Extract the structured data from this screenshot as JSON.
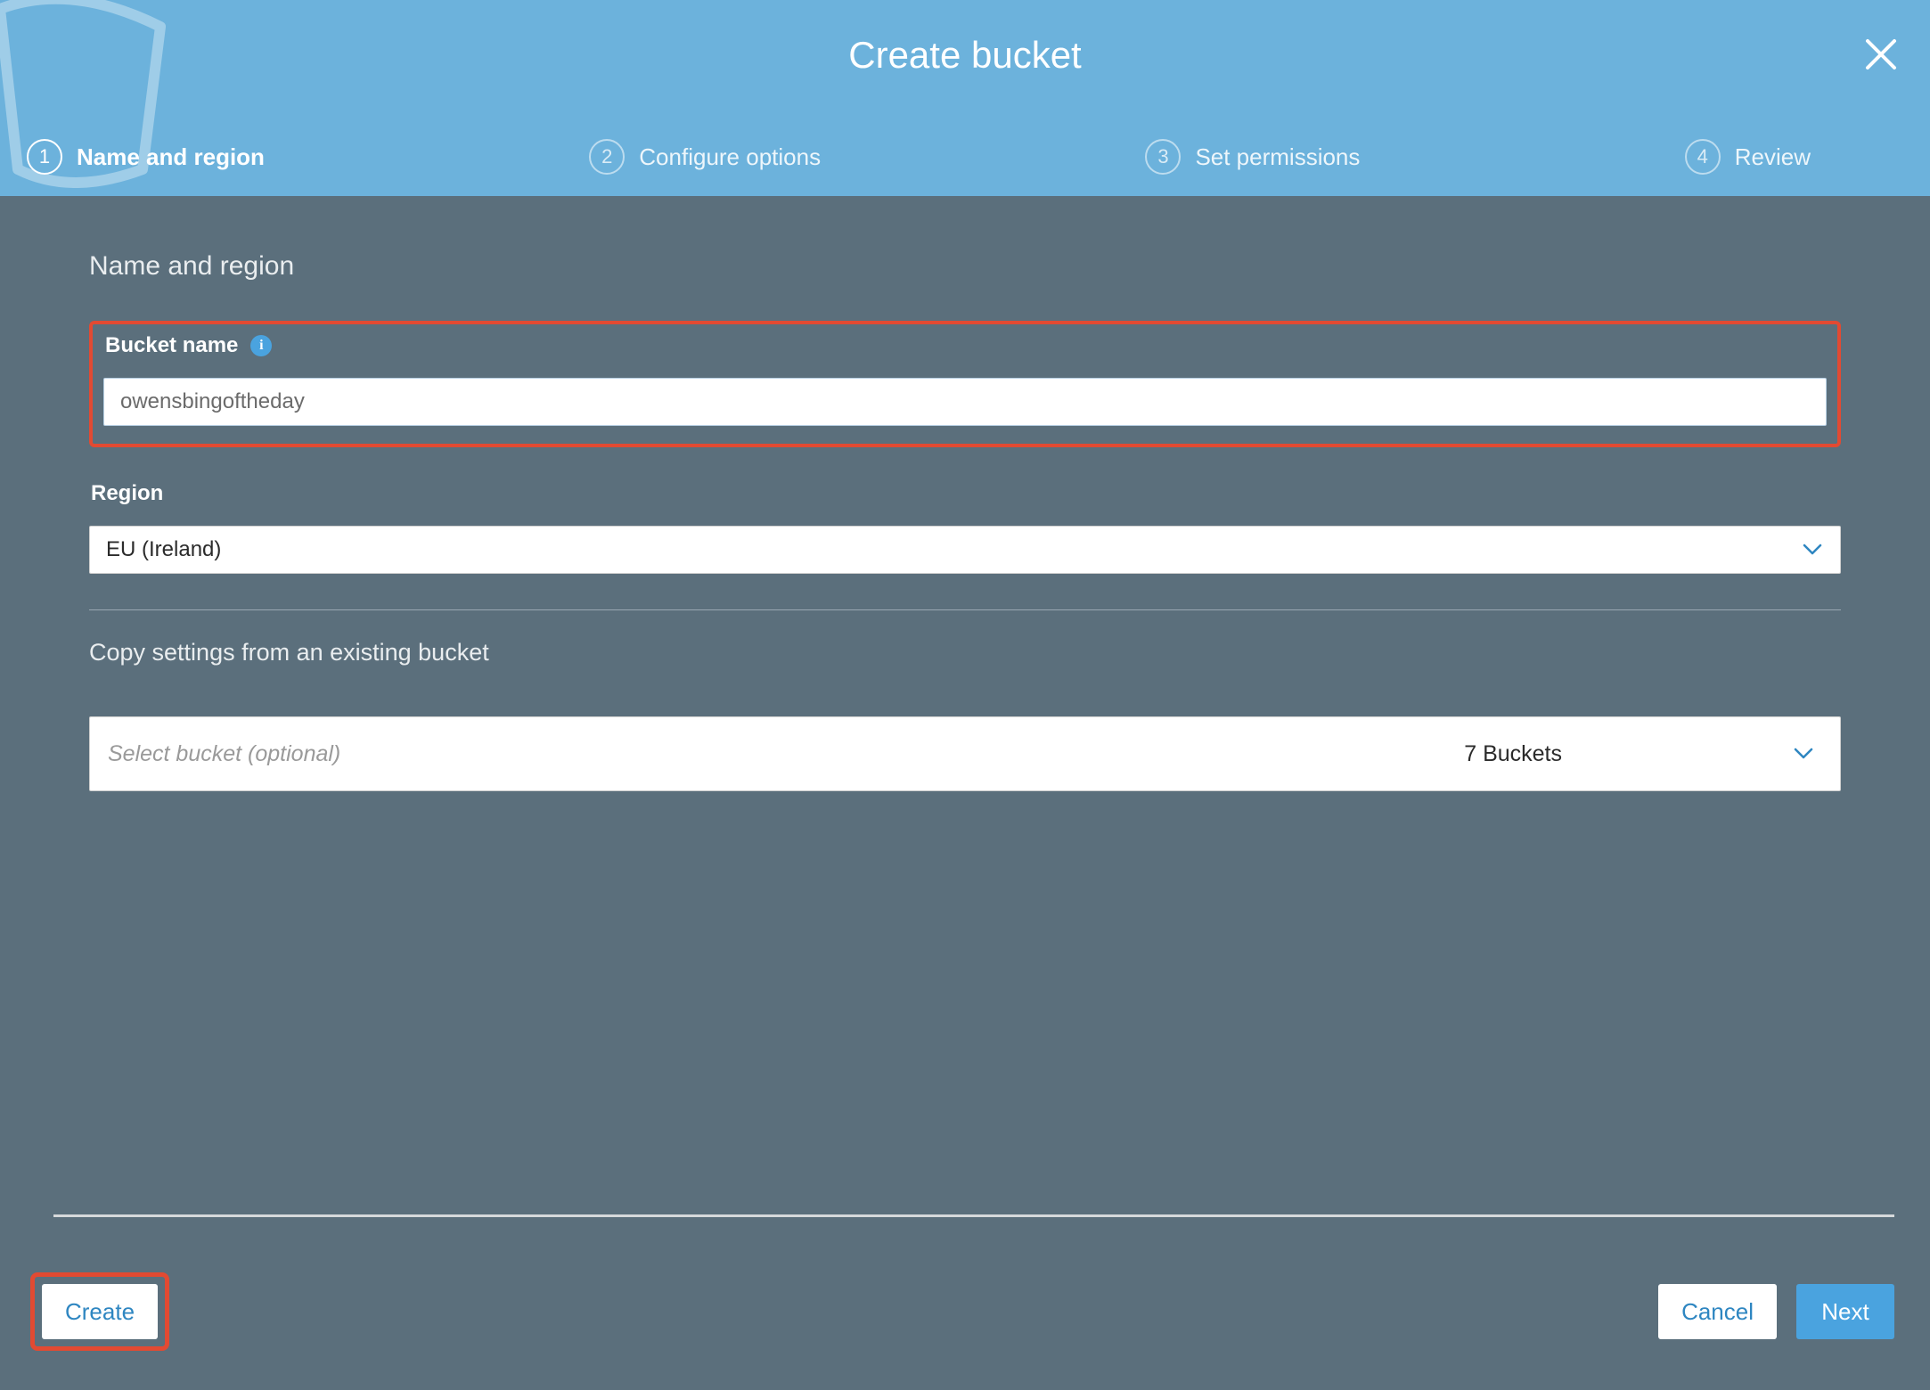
{
  "header": {
    "title": "Create bucket",
    "steps": [
      {
        "num": "1",
        "label": "Name and region",
        "active": true
      },
      {
        "num": "2",
        "label": "Configure options",
        "active": false
      },
      {
        "num": "3",
        "label": "Set permissions",
        "active": false
      },
      {
        "num": "4",
        "label": "Review",
        "active": false
      }
    ]
  },
  "form": {
    "section_title": "Name and region",
    "bucket_name_label": "Bucket name",
    "bucket_name_value": "owensbingoftheday",
    "region_label": "Region",
    "region_value": "EU (Ireland)",
    "copy_title": "Copy settings from an existing bucket",
    "copy_placeholder": "Select bucket (optional)",
    "buckets_count": "7 Buckets"
  },
  "actions": {
    "create": "Create",
    "cancel": "Cancel",
    "next": "Next"
  }
}
